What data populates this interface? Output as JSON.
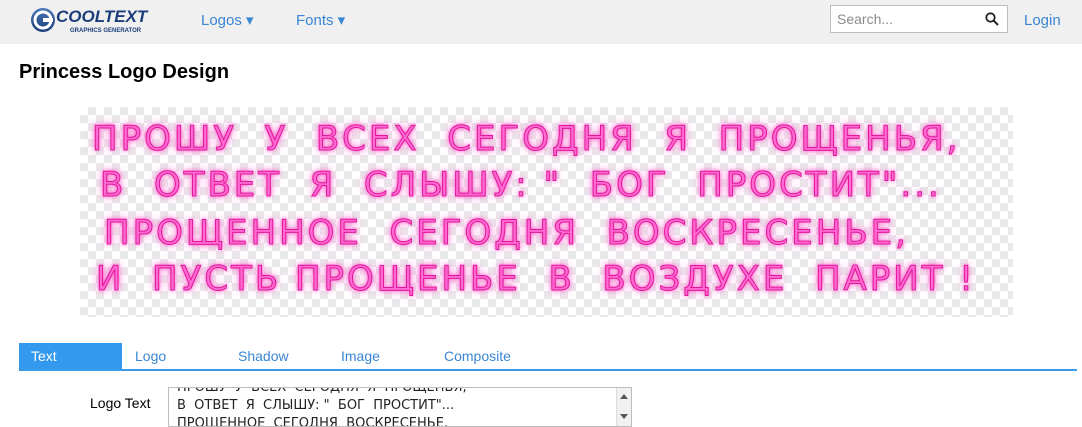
{
  "header": {
    "logo_text": "COOLTEXT",
    "logo_subtext": "GRAPHICS GENERATOR",
    "nav": {
      "logos_label": "Logos ▾",
      "fonts_label": "Fonts ▾"
    },
    "search": {
      "placeholder": "Search...",
      "value": ""
    },
    "login_label": "Login"
  },
  "page": {
    "title": "Princess Logo Design"
  },
  "preview": {
    "lines": [
      "ПРОШУ  У  ВСЕХ  СЕГОДНЯ  Я  ПРОЩЕНЬЯ,",
      "В  ОТВЕТ  Я  СЛЫШУ: \"  БОГ  ПРОСТИТ\"...",
      "ПРОЩЕННОЕ  СЕГОДНЯ  ВОСКРЕСЕНЬЕ,",
      "И  ПУСТЬ ПРОЩЕНЬЕ  В  ВОЗДУХЕ  ПАРИТ !"
    ],
    "colors": {
      "fill": "#ff6ad0",
      "glow": "#ff4fc4",
      "stroke": "#e0179c"
    }
  },
  "tabs": [
    {
      "label": "Text",
      "active": true
    },
    {
      "label": "Logo",
      "active": false
    },
    {
      "label": "Shadow",
      "active": false
    },
    {
      "label": "Image",
      "active": false
    },
    {
      "label": "Composite",
      "active": false
    }
  ],
  "form": {
    "logo_text_label": "Logo Text",
    "logo_text_value": "ПРОШУ  У  ВСЕХ  СЕГОДНЯ  Я  ПРОЩЕНЬЯ,\nВ  ОТВЕТ  Я  СЛЫШУ: \"  БОГ  ПРОСТИТ\"...\nПРОЩЕННОЕ  СЕГОДНЯ  ВОСКРЕСЕНЬЕ,\nИ  ПУСТЬ ПРОЩЕНЬЕ  В  ВОЗДУХЕ  ПАРИТ !"
  },
  "theme": {
    "accent": "#3399ee",
    "link": "#3a86d4",
    "topbar_bg": "#f0f0f0"
  },
  "icons": {
    "search": "search-icon",
    "logo": "cooltext-logo-icon"
  }
}
